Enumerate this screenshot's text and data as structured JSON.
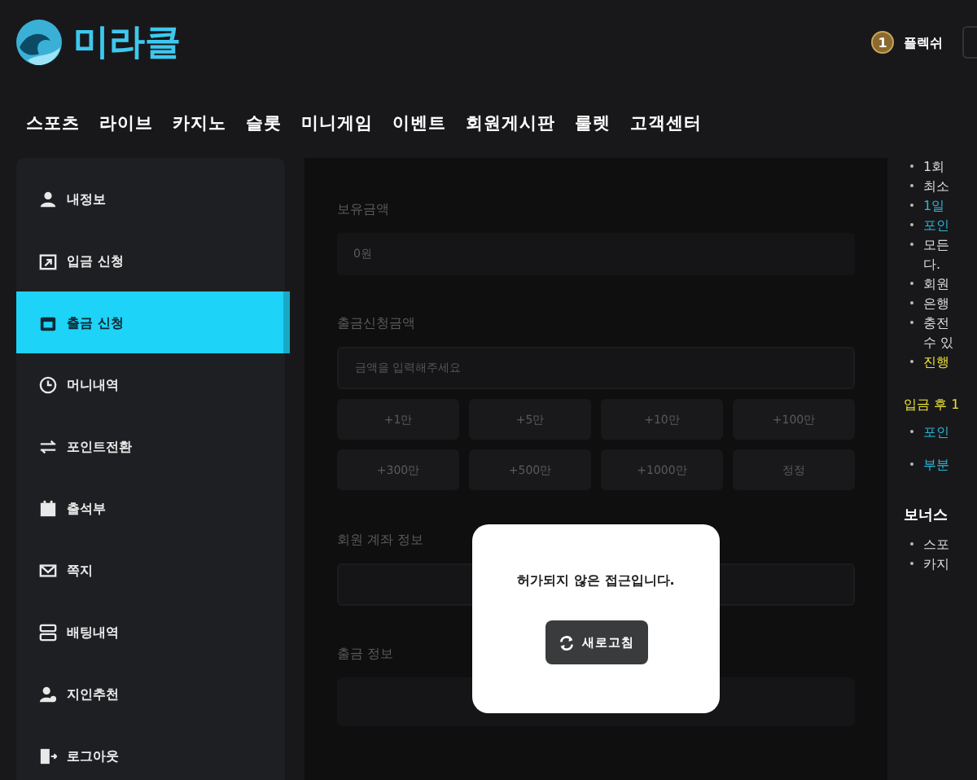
{
  "header": {
    "logo_text": "미라클",
    "level_badge": "1",
    "username": "플렉쉬"
  },
  "nav": [
    "스포츠",
    "라이브",
    "카지노",
    "슬롯",
    "미니게임",
    "이벤트",
    "회원게시판",
    "룰렛",
    "고객센터"
  ],
  "sidebar": [
    {
      "label": "내정보",
      "selected": false
    },
    {
      "label": "입금 신청",
      "selected": false
    },
    {
      "label": "출금 신청",
      "selected": true
    },
    {
      "label": "머니내역",
      "selected": false
    },
    {
      "label": "포인트전환",
      "selected": false
    },
    {
      "label": "출석부",
      "selected": false
    },
    {
      "label": "쪽지",
      "selected": false
    },
    {
      "label": "배팅내역",
      "selected": false
    },
    {
      "label": "지인추천",
      "selected": false
    },
    {
      "label": "로그아웃",
      "selected": false
    }
  ],
  "form": {
    "balance_label": "보유금액",
    "balance_value": "0원",
    "amount_label": "출금신청금액",
    "amount_placeholder": "금액을 입력해주세요",
    "amount_buttons": [
      "+1만",
      "+5만",
      "+10만",
      "+100만",
      "+300만",
      "+500만",
      "+1000만",
      "정정"
    ],
    "account_label": "회원 계좌 정보",
    "info_label": "출금 정보"
  },
  "notes": {
    "items": [
      {
        "text": "1회",
        "color": "#dddddd"
      },
      {
        "text": "최소",
        "color": "#dddddd"
      },
      {
        "text": "1일",
        "color": "#2ab7dd"
      },
      {
        "text": "포인",
        "color": "#2ab7dd"
      },
      {
        "text": "모든",
        "color": "#dddddd",
        "cont": "다."
      },
      {
        "text": "회원",
        "color": "#dddddd"
      },
      {
        "text": "은행",
        "color": "#dddddd"
      },
      {
        "text": "충전",
        "color": "#dddddd",
        "cont": "수 있"
      },
      {
        "text": "진행",
        "color": "#e8e036"
      }
    ],
    "section2_title": "입금 후 1",
    "section2": [
      {
        "text": "포인",
        "color": "#2ab7dd"
      },
      {
        "text": "부분",
        "color": "#2ab7dd"
      }
    ],
    "section3_title": "보너스",
    "section3": [
      {
        "text": "스포",
        "color": "#dddddd"
      },
      {
        "text": "카지",
        "color": "#dddddd"
      }
    ]
  },
  "modal": {
    "message": "허가되지 않은 접근입니다.",
    "button": "새로고침"
  }
}
